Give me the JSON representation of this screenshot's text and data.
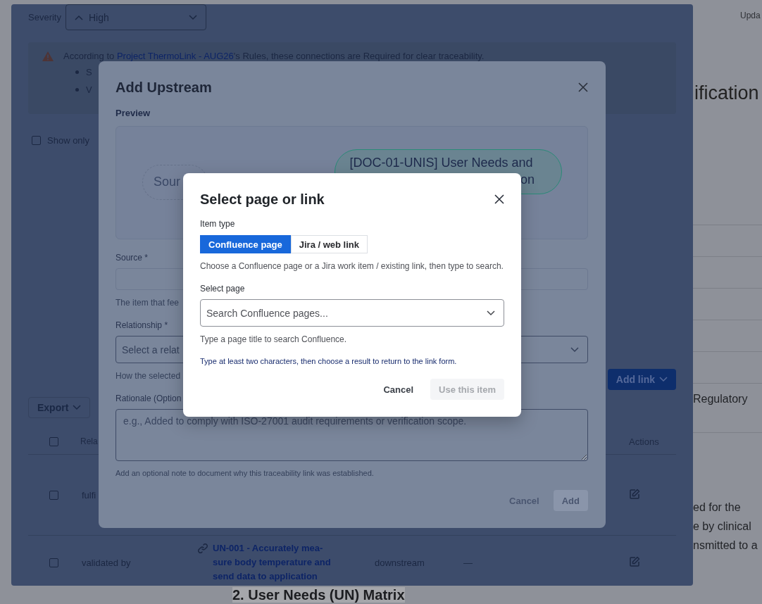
{
  "page": {
    "update_label": "Upda",
    "heading": "ification",
    "side_cell": "Regulatory",
    "paragraph_lines": [
      "ed for the",
      "e by clinical",
      "nsmitted to a"
    ],
    "section_heading": "2. User Needs (UN) Matrix"
  },
  "panel": {
    "severity": {
      "label": "Severity",
      "value": "High"
    },
    "alert": {
      "before": "According to ",
      "link": "Project ThermoLink - AUG26",
      "after": "'s Rules, these connections are Required for clear traceability.",
      "bullets": [
        "S",
        "V"
      ]
    },
    "filter": {
      "label": "Show only",
      "checked": false
    },
    "export_button": "Export",
    "add_link_button": "Add link",
    "table": {
      "header_checked": false,
      "columns": [
        "Rela",
        "Actions"
      ],
      "rows": [
        {
          "checked": false,
          "relation": "fulfi"
        },
        {
          "checked": false,
          "relation": "validated by",
          "item": "UN-001 - Accurately mea-sure body temperature and send data to application",
          "direction": "downstream",
          "note": "—"
        }
      ]
    }
  },
  "modal": {
    "title": "Add Upstream",
    "preview_label": "Preview",
    "source_node": "Sour",
    "target_node_lines": [
      "[DOC-01-UNIS] User Needs and",
      "on"
    ],
    "fields": [
      {
        "kind": "input",
        "label": "Source *",
        "helper": "The item that fee"
      },
      {
        "kind": "select",
        "label": "Relationship *",
        "placeholder": "Select a relat",
        "helper": "How the selected"
      },
      {
        "kind": "textarea",
        "label": "Rationale (Option",
        "placeholder": "e.g., Added to comply with ISO-27001 audit requirements or verification scope.",
        "helper": "Add an optional note to document why this traceability link was established."
      }
    ],
    "buttons": [
      {
        "label": "Cancel",
        "kind": "secondary",
        "disabled": true
      },
      {
        "label": "Add",
        "kind": "primary",
        "disabled": true
      }
    ]
  },
  "dialog": {
    "title": "Select page or link",
    "item_type_label": "Item type",
    "tabs": [
      {
        "label": "Confluence page",
        "selected": true
      },
      {
        "label": "Jira / web link",
        "selected": false
      }
    ],
    "hint": "Choose a Confluence page or a Jira work item / existing link, then type to search.",
    "select_label": "Select page",
    "search": {
      "placeholder": "Search Confluence pages..."
    },
    "search_help": "Type a page title to search Confluence.",
    "note": "Type at least two characters, then choose a result to return to the link form.",
    "buttons": [
      {
        "label": "Cancel",
        "kind": "secondary",
        "disabled": false
      },
      {
        "label": "Use this item",
        "kind": "primary",
        "disabled": true
      }
    ]
  }
}
